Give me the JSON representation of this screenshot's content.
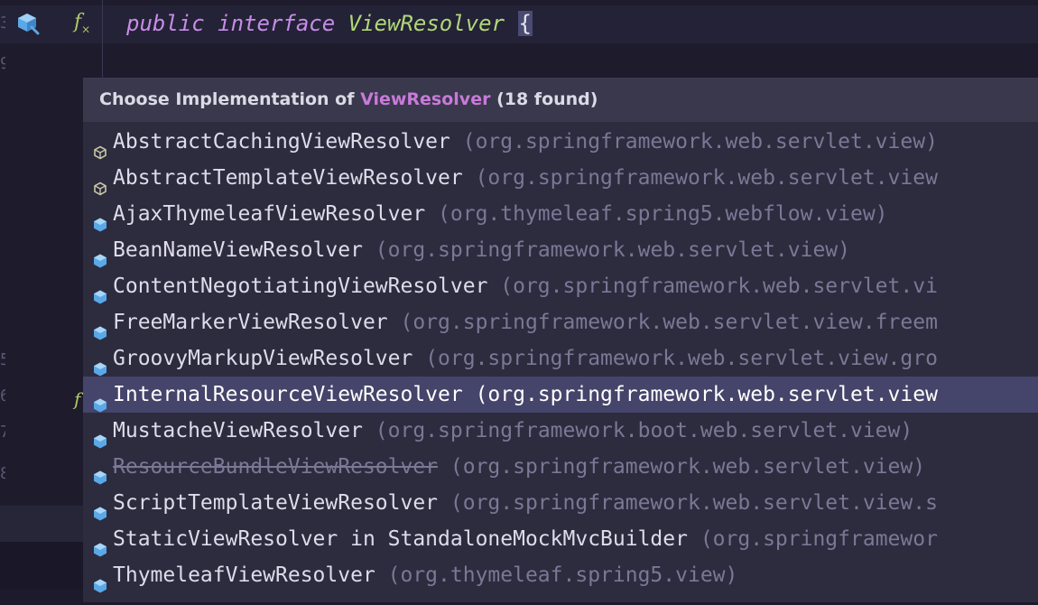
{
  "editor": {
    "line_numbers": [
      "3",
      "9",
      "5",
      "6",
      "7",
      "8"
    ],
    "code": {
      "kw1": "public",
      "kw2": "interface",
      "class_name": "ViewResolver",
      "brace": "{"
    },
    "gutter_icons": [
      "interface-icon",
      "fx-icon"
    ]
  },
  "popup": {
    "title_prefix": "Choose Implementation of ",
    "title_class": "ViewResolver",
    "title_suffix": " (18 found)",
    "items": [
      {
        "name": "AbstractCachingViewResolver",
        "pkg": " (org.springframework.web.servlet.view)",
        "icon": "abstract-class-icon"
      },
      {
        "name": "AbstractTemplateViewResolver",
        "pkg": " (org.springframework.web.servlet.view",
        "icon": "abstract-class-icon"
      },
      {
        "name": "AjaxThymeleafViewResolver",
        "pkg": " (org.thymeleaf.spring5.webflow.view)",
        "icon": "class-icon"
      },
      {
        "name": "BeanNameViewResolver",
        "pkg": " (org.springframework.web.servlet.view)",
        "icon": "class-icon"
      },
      {
        "name": "ContentNegotiatingViewResolver",
        "pkg": " (org.springframework.web.servlet.vi",
        "icon": "class-icon"
      },
      {
        "name": "FreeMarkerViewResolver",
        "pkg": " (org.springframework.web.servlet.view.freem",
        "icon": "class-icon"
      },
      {
        "name": "GroovyMarkupViewResolver",
        "pkg": " (org.springframework.web.servlet.view.gro",
        "icon": "class-icon"
      },
      {
        "name": "InternalResourceViewResolver",
        "pkg": " (org.springframework.web.servlet.view",
        "icon": "class-icon",
        "selected": true
      },
      {
        "name": "MustacheViewResolver",
        "pkg": " (org.springframework.boot.web.servlet.view)",
        "icon": "class-icon"
      },
      {
        "name": "ResourceBundleViewResolver",
        "pkg": " (org.springframework.web.servlet.view)",
        "icon": "class-icon",
        "deprecated": true
      },
      {
        "name": "ScriptTemplateViewResolver",
        "pkg": " (org.springframework.web.servlet.view.s",
        "icon": "class-icon"
      },
      {
        "name": "StaticViewResolver in StandaloneMockMvcBuilder",
        "pkg": " (org.springframewor",
        "icon": "class-icon"
      },
      {
        "name": "ThymeleafViewResolver",
        "pkg": " (org.thymeleaf.spring5.view)",
        "icon": "class-icon"
      }
    ]
  },
  "colors": {
    "background": "#1d1b2c",
    "popup_bg": "#2d2b3e",
    "popup_header_bg": "#3a384c",
    "selection": "#45446a",
    "keyword": "#c78ce8",
    "class_name": "#b0d77a",
    "highlight": "#c87ad9",
    "icon_class": "#5aa8e8"
  }
}
